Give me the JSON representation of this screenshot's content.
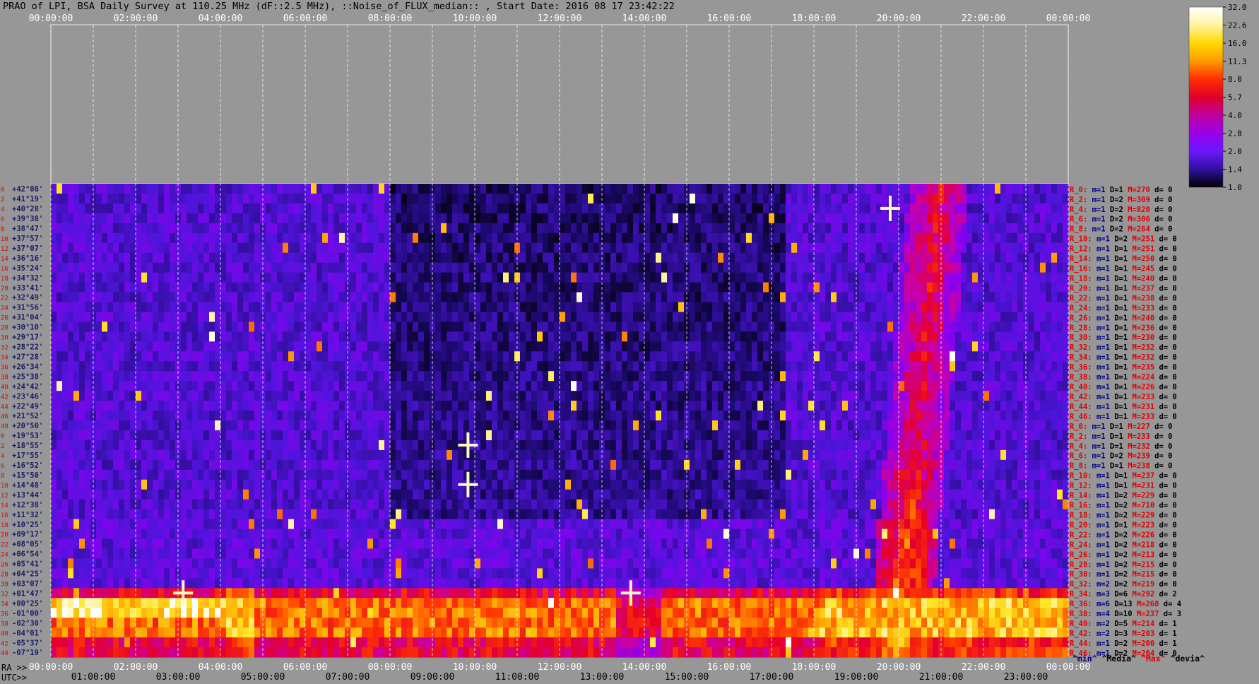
{
  "title": "PRAO of LPI, BSA Daily Survey at 110.25 MHz (dF::2.5 MHz), ::Noise_of_FLUX_median:: , Start Date: 2016 08 17 23:42:22",
  "chart_data": {
    "type": "heatmap",
    "top_time_ticks": [
      "00:00:00",
      "02:00:00",
      "04:00:00",
      "06:00:00",
      "08:00:00",
      "10:00:00",
      "12:00:00",
      "14:00:00",
      "16:00:00",
      "18:00:00",
      "20:00:00",
      "22:00:00",
      "00:00:00"
    ],
    "ra_prefix": "RA >>",
    "ra_ticks": [
      "00:00:00",
      "02:00:00",
      "04:00:00",
      "06:00:00",
      "08:00:00",
      "10:00:00",
      "12:00:00",
      "14:00:00",
      "16:00:00",
      "18:00:00",
      "20:00:00",
      "22:00:00",
      "00:00:00"
    ],
    "utc_prefix": "UTC>>",
    "utc_ticks": [
      "01:00:00",
      "03:00:00",
      "05:00:00",
      "07:00:00",
      "09:00:00",
      "11:00:00",
      "13:00:00",
      "15:00:00",
      "17:00:00",
      "19:00:00",
      "21:00:00",
      "23:00:00"
    ],
    "colorbar": {
      "ticks": [
        "32.0",
        "22.6",
        "16.0",
        "11.3",
        "8.0",
        "5.7",
        "4.0",
        "2.8",
        "2.0",
        "1.4",
        "1.0"
      ],
      "colors": [
        "#ffffff",
        "#fff4a0",
        "#ffd800",
        "#ff9a00",
        "#ff3000",
        "#e00028",
        "#c000a0",
        "#9a00e8",
        "#6a18ff",
        "#3010a0",
        "#000000"
      ]
    },
    "declinations": [
      "+42°08'",
      "+41°19'",
      "+40°28'",
      "+39°38'",
      "+38°47'",
      "+37°57'",
      "+37°07'",
      "+36°16'",
      "+35°24'",
      "+34°32'",
      "+33°41'",
      "+32°49'",
      "+31°56'",
      "+31°04'",
      "+30°10'",
      "+29°17'",
      "+28°22'",
      "+27°28'",
      "+26°34'",
      "+25°38'",
      "+24°42'",
      "+23°46'",
      "+22°49'",
      "+21°52'",
      "+20°50'",
      "+19°53'",
      "+18°55'",
      "+17°55'",
      "+16°52'",
      "+15°50'",
      "+14°48'",
      "+13°44'",
      "+12°38'",
      "+11°32'",
      "+10°25'",
      "+09°17'",
      "+08°05'",
      "+06°54'",
      "+05°41'",
      "+04°25'",
      "+03°07'",
      "+01°47'",
      "+00°25'",
      "-01°00'",
      "-02°30'",
      "-04°01'",
      "-05°37'",
      "-07°19'"
    ],
    "row_indices": [
      "0",
      "2",
      "4",
      "6",
      "8",
      "10",
      "12",
      "14",
      "16",
      "18",
      "20",
      "22",
      "24",
      "26",
      "28",
      "30",
      "32",
      "34",
      "36",
      "38",
      "40",
      "42",
      "44",
      "46",
      "48",
      "0",
      "2",
      "4",
      "6",
      "8",
      "10",
      "12",
      "14",
      "16",
      "18",
      "20",
      "22",
      "24",
      "26",
      "28",
      "30",
      "32",
      "34",
      "36",
      "38",
      "40",
      "42",
      "44",
      "46"
    ],
    "beam_stats": [
      {
        "r": "R_0:",
        "m": "1",
        "D": "1",
        "M": "270",
        "d": "0"
      },
      {
        "r": "R_2:",
        "m": "1",
        "D": "2",
        "M": "309",
        "d": "0"
      },
      {
        "r": "R_4:",
        "m": "1",
        "D": "2",
        "M": "820",
        "d": "0"
      },
      {
        "r": "R_6:",
        "m": "1",
        "D": "2",
        "M": "306",
        "d": "0"
      },
      {
        "r": "R_8:",
        "m": "1",
        "D": "2",
        "M": "264",
        "d": "0"
      },
      {
        "r": "R_10:",
        "m": "1",
        "D": "2",
        "M": "251",
        "d": "0"
      },
      {
        "r": "R_12:",
        "m": "1",
        "D": "1",
        "M": "251",
        "d": "0"
      },
      {
        "r": "R_14:",
        "m": "1",
        "D": "1",
        "M": "250",
        "d": "0"
      },
      {
        "r": "R_16:",
        "m": "1",
        "D": "1",
        "M": "245",
        "d": "0"
      },
      {
        "r": "R_18:",
        "m": "1",
        "D": "1",
        "M": "240",
        "d": "0"
      },
      {
        "r": "R_20:",
        "m": "1",
        "D": "1",
        "M": "237",
        "d": "0"
      },
      {
        "r": "R_22:",
        "m": "1",
        "D": "1",
        "M": "238",
        "d": "0"
      },
      {
        "r": "R_24:",
        "m": "1",
        "D": "1",
        "M": "233",
        "d": "0"
      },
      {
        "r": "R_26:",
        "m": "1",
        "D": "1",
        "M": "240",
        "d": "0"
      },
      {
        "r": "R_28:",
        "m": "1",
        "D": "1",
        "M": "236",
        "d": "0"
      },
      {
        "r": "R_30:",
        "m": "1",
        "D": "1",
        "M": "230",
        "d": "0"
      },
      {
        "r": "R_32:",
        "m": "1",
        "D": "1",
        "M": "232",
        "d": "0"
      },
      {
        "r": "R_34:",
        "m": "1",
        "D": "1",
        "M": "232",
        "d": "0"
      },
      {
        "r": "R_36:",
        "m": "1",
        "D": "1",
        "M": "235",
        "d": "0"
      },
      {
        "r": "R_38:",
        "m": "1",
        "D": "1",
        "M": "224",
        "d": "0"
      },
      {
        "r": "R_40:",
        "m": "1",
        "D": "1",
        "M": "226",
        "d": "0"
      },
      {
        "r": "R_42:",
        "m": "1",
        "D": "1",
        "M": "233",
        "d": "0"
      },
      {
        "r": "R_44:",
        "m": "1",
        "D": "1",
        "M": "231",
        "d": "0"
      },
      {
        "r": "R_46:",
        "m": "1",
        "D": "1",
        "M": "233",
        "d": "0"
      },
      {
        "r": "R_0:",
        "m": "1",
        "D": "1",
        "M": "227",
        "d": "0"
      },
      {
        "r": "R_2:",
        "m": "1",
        "D": "1",
        "M": "233",
        "d": "0"
      },
      {
        "r": "R_4:",
        "m": "1",
        "D": "1",
        "M": "232",
        "d": "0"
      },
      {
        "r": "R_6:",
        "m": "1",
        "D": "2",
        "M": "239",
        "d": "0"
      },
      {
        "r": "R_8:",
        "m": "1",
        "D": "1",
        "M": "238",
        "d": "0"
      },
      {
        "r": "R_10:",
        "m": "1",
        "D": "1",
        "M": "237",
        "d": "0"
      },
      {
        "r": "R_12:",
        "m": "1",
        "D": "1",
        "M": "231",
        "d": "0"
      },
      {
        "r": "R_14:",
        "m": "1",
        "D": "2",
        "M": "229",
        "d": "0"
      },
      {
        "r": "R_16:",
        "m": "1",
        "D": "2",
        "M": "710",
        "d": "0"
      },
      {
        "r": "R_18:",
        "m": "1",
        "D": "2",
        "M": "229",
        "d": "0"
      },
      {
        "r": "R_20:",
        "m": "1",
        "D": "1",
        "M": "223",
        "d": "0"
      },
      {
        "r": "R_22:",
        "m": "1",
        "D": "2",
        "M": "226",
        "d": "0"
      },
      {
        "r": "R_24:",
        "m": "1",
        "D": "2",
        "M": "218",
        "d": "0"
      },
      {
        "r": "R_26:",
        "m": "1",
        "D": "2",
        "M": "213",
        "d": "0"
      },
      {
        "r": "R_28:",
        "m": "1",
        "D": "2",
        "M": "215",
        "d": "0"
      },
      {
        "r": "R_30:",
        "m": "1",
        "D": "2",
        "M": "215",
        "d": "0"
      },
      {
        "r": "R_32:",
        "m": "2",
        "D": "2",
        "M": "219",
        "d": "0"
      },
      {
        "r": "R_34:",
        "m": "3",
        "D": "6",
        "M": "292",
        "d": "2"
      },
      {
        "r": "R_36:",
        "m": "6",
        "D": "13",
        "M": "268",
        "d": "4"
      },
      {
        "r": "R_38:",
        "m": "4",
        "D": "10",
        "M": "237",
        "d": "3"
      },
      {
        "r": "R_40:",
        "m": "2",
        "D": "5",
        "M": "214",
        "d": "1"
      },
      {
        "r": "R_42:",
        "m": "2",
        "D": "3",
        "M": "203",
        "d": "1"
      },
      {
        "r": "R_44:",
        "m": "1",
        "D": "2",
        "M": "200",
        "d": "1"
      },
      {
        "r": "R_46:",
        "m": "1",
        "D": "2",
        "M": "204",
        "d": "0"
      }
    ],
    "legend": {
      "min": "^min^",
      "media": "^Media^",
      "max": "^Max^",
      "devia": "^devia^"
    }
  }
}
